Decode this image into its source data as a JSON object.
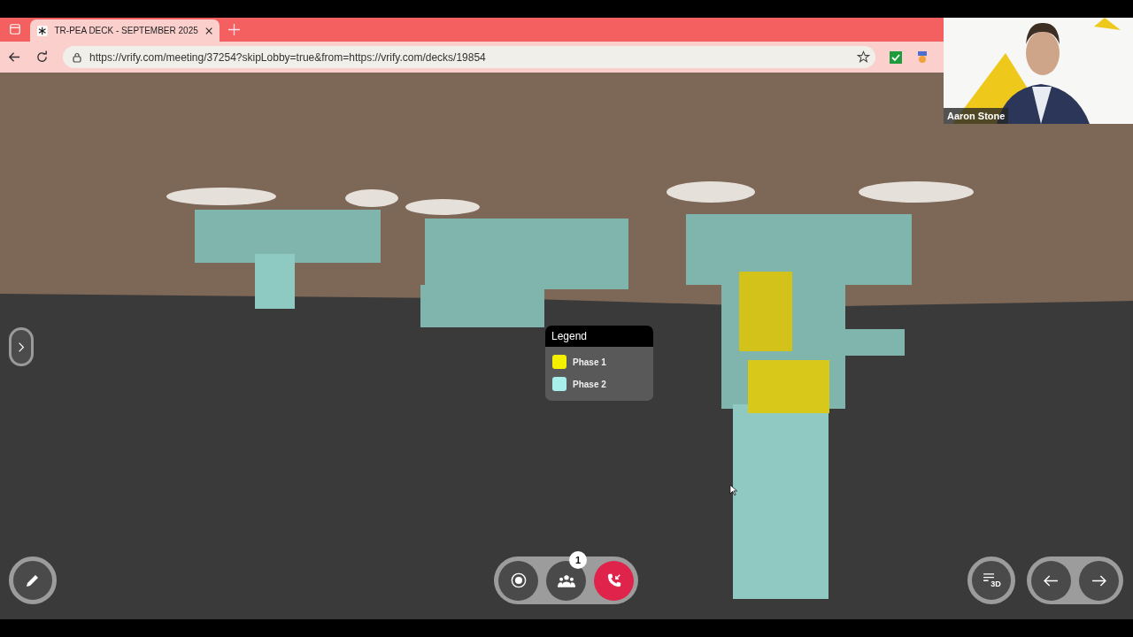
{
  "browser": {
    "tab_title": "TR-PEA DECK - SEPTEMBER 2025",
    "url": "https://vrify.com/meeting/37254?skipLobby=true&from=https://vrify.com/decks/19854"
  },
  "video": {
    "name": "Aaron Stone"
  },
  "legend": {
    "title": "Legend",
    "items": [
      {
        "label": "Phase 1",
        "color": "#f5ef00"
      },
      {
        "label": "Phase 2",
        "color": "#a8eeea"
      }
    ]
  },
  "call_controls": {
    "participants_count": "1"
  },
  "view_button": {
    "label": "3D"
  }
}
